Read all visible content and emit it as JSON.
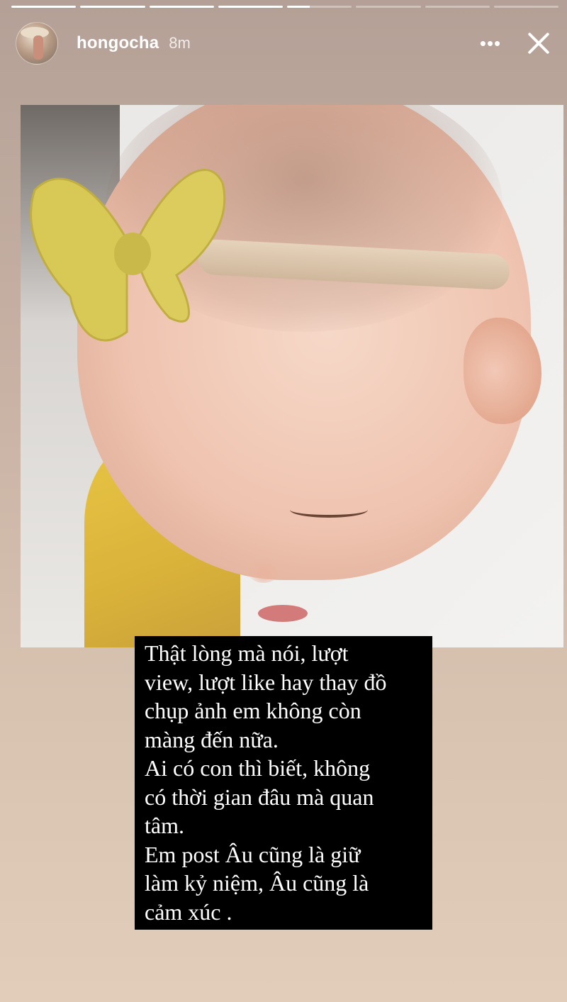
{
  "story": {
    "username": "hongocha",
    "time_ago": "8m",
    "progress": {
      "segments": 8,
      "completed": 4,
      "current_index": 4,
      "current_progress": 0.35
    },
    "more_icon": "more-horizontal-icon",
    "close_icon": "close-icon",
    "caption_lines": [
      "Thật lòng mà nói, lượt",
      "view, lượt like hay thay đồ",
      "chụp ảnh em không còn",
      "màng đến nữa.",
      "Ai có con thì biết, không",
      "có thời gian đâu mà quan",
      "tâm.",
      "Em post Âu cũng là giữ",
      "làm kỷ niệm, Âu cũng là",
      "cảm xúc ."
    ]
  }
}
